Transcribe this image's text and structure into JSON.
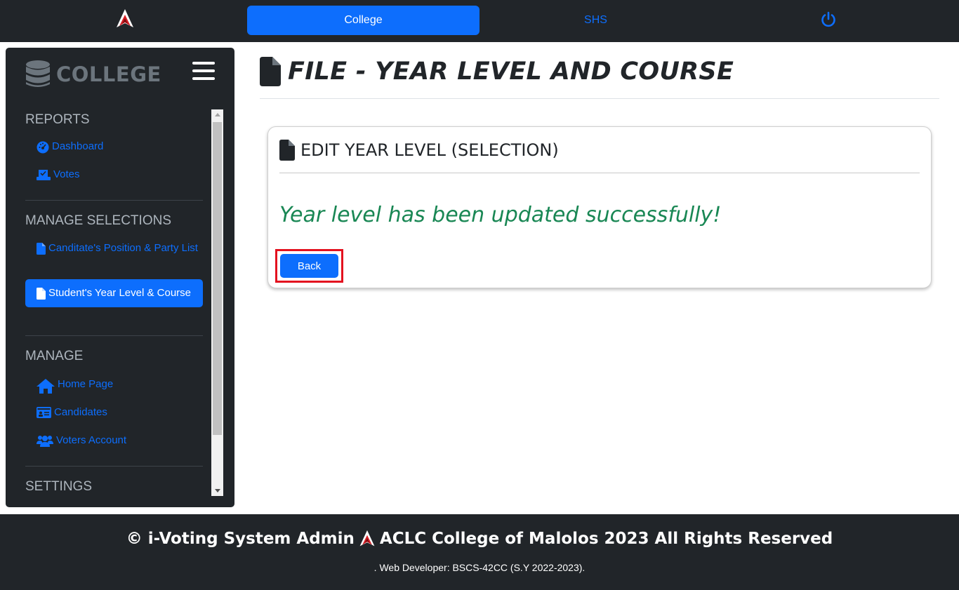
{
  "topbar": {
    "tabs": [
      {
        "label": "College",
        "active": true
      },
      {
        "label": "SHS",
        "active": false
      }
    ],
    "icons": {
      "logo": "aclc-logo-icon",
      "power": "power-icon"
    }
  },
  "sidebar": {
    "brand": "COLLEGE",
    "sections": [
      {
        "title": "REPORTS",
        "items": [
          {
            "label": "Dashboard",
            "icon": "gauge-icon"
          },
          {
            "label": "Votes",
            "icon": "ballot-box-icon"
          }
        ]
      },
      {
        "title": "MANAGE SELECTIONS",
        "items": [
          {
            "label": "Canditate's Position & Party List",
            "icon": "file-icon"
          },
          {
            "label": "Student's Year Level & Course",
            "icon": "file-icon",
            "active": true
          }
        ]
      },
      {
        "title": "MANAGE",
        "items": [
          {
            "label": "Home Page",
            "icon": "home-icon"
          },
          {
            "label": "Candidates",
            "icon": "id-card-icon"
          },
          {
            "label": "Voters Account",
            "icon": "users-icon"
          }
        ]
      },
      {
        "title": "SETTINGS",
        "items": []
      }
    ]
  },
  "main": {
    "page_title": "FILE - YEAR LEVEL AND COURSE",
    "card": {
      "title": "EDIT YEAR LEVEL (SELECTION)",
      "message": "Year level has been updated successfully!",
      "back_label": "Back"
    }
  },
  "footer": {
    "line1_left": "© i-Voting System Admin",
    "line1_right": "ACLC College of Malolos 2023 All Rights Reserved",
    "line2": ". Web Developer: BSCS-42CC (S.Y 2022-2023)."
  },
  "colors": {
    "primary": "#0d6efd",
    "dark": "#212529",
    "success": "#198754",
    "highlight": "#e3121f"
  }
}
